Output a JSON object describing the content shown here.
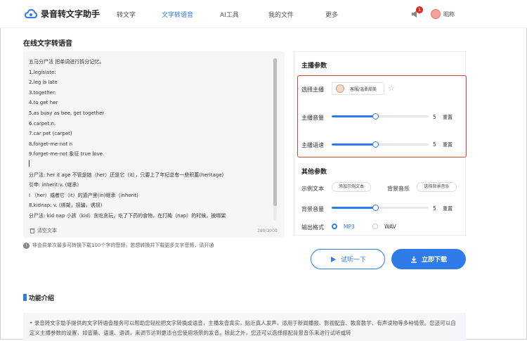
{
  "header": {
    "app_title": "录音转文字助手",
    "nav": [
      "转文字",
      "文字转语音",
      "AI工具",
      "我的文件",
      "更多"
    ],
    "active_nav": "文字转语音",
    "notification_count": "1",
    "nickname": "昵称"
  },
  "page_title": "在线文字转语音",
  "editor": {
    "lines": [
      "五马分尸法  把单词进行拆分记忆。",
      "1.legislate:",
      "2.leg is late",
      "3.together:",
      "4.to get her",
      "5.as busy as bee, get together",
      "6.carpet:n.",
      "7.car pet (carpet)",
      "8.forget-me-not n",
      "9.forget-me-not 象征 true love.",
      "",
      "分尸法: her it age 不管是她（her）还是它（it），只要上了年纪总有一些积蓄(heritage)",
      "引申: inherit:v. (继承)",
      "I （her）或者它（it）的遗产里(in)继承（inherit)",
      "8.kidnap: v. (绑架，拐骗，诱拐)",
      "分尸法:   kid  nap  小孩（kid）贪吃贪玩，吃了下药的食物，在打盹（nap）的时候，被绑架"
    ],
    "clear_label": "清空文本",
    "counter": "380/3000"
  },
  "notice": "非会员单次最多可转换下载100个字的音频，若想转换并下载更多文字音频，请开通",
  "anchor_params": {
    "title": "主播参数",
    "select_label": "选择主播",
    "anchor_button": "客服/温柔甜美",
    "volume_label": "主播音量",
    "volume_value": "5",
    "volume_fraction": 0.45,
    "speed_label": "主播语速",
    "speed_value": "5",
    "speed_fraction": 0.45,
    "reset_label": "重置"
  },
  "other_params": {
    "title": "其他参数",
    "sample_label": "示例文本",
    "sample_button": "添加示例文本",
    "music_label": "背景音乐",
    "music_button": "选择背景音乐",
    "bg_volume_label": "背景音量",
    "bg_volume_value": "5",
    "bg_volume_fraction": 0.45,
    "reset_label": "重置",
    "format_label": "输出格式",
    "format_options": [
      "MP3",
      "WAV"
    ],
    "format_selected": "MP3"
  },
  "actions": {
    "try_label": "试听一下",
    "download_label": "立即下载"
  },
  "intro": {
    "title": "功能介绍",
    "text": "录音转文字助手提供的文字转语音服务可以帮助您轻松把文字转换成语音，主播发音真实，贴近真人发声，适用于新闻播报、影视配音、教育教学、有声读物等多种情景。您还可以自定义主播参数的设置，如音量、语速、语调，来调节达到更适合您使用场景的发音。除此之外，您还可以选择搭配背景音乐来进行试听或转"
  },
  "colors": {
    "accent": "#2f7bea",
    "highlight": "#d9442b"
  }
}
